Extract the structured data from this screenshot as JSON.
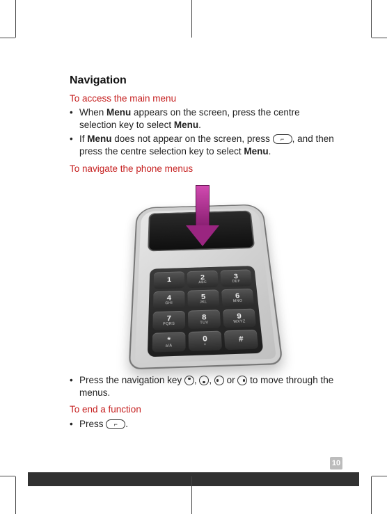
{
  "heading": "Navigation",
  "section_access": {
    "title": "To access the main menu",
    "bullets": [
      {
        "pre": "When ",
        "bold1": "Menu",
        "mid": " appears on the screen, press the centre selection key to select ",
        "bold2": "Menu",
        "post": "."
      },
      {
        "pre": "If ",
        "bold1": "Menu",
        "mid": " does not appear on the screen, press ",
        "icon": "hangup",
        "mid2": ", and then press the centre selection key to select ",
        "bold2": "Menu",
        "post": "."
      }
    ]
  },
  "section_navigate": {
    "title": "To navigate the phone menus"
  },
  "keypad": [
    {
      "digit": "1",
      "letters": ""
    },
    {
      "digit": "2",
      "letters": "ABC"
    },
    {
      "digit": "3",
      "letters": "DEF"
    },
    {
      "digit": "4",
      "letters": "GHI"
    },
    {
      "digit": "5",
      "letters": "JKL"
    },
    {
      "digit": "6",
      "letters": "MNO"
    },
    {
      "digit": "7",
      "letters": "PQRS"
    },
    {
      "digit": "8",
      "letters": "TUV"
    },
    {
      "digit": "9",
      "letters": "WXYZ"
    },
    {
      "digit": "*",
      "letters": "a/A"
    },
    {
      "digit": "0",
      "letters": "+"
    },
    {
      "digit": "#",
      "letters": ""
    }
  ],
  "section_press": {
    "bullet_pre": "Press the navigation key ",
    "bullet_sep": ", ",
    "bullet_or": " or ",
    "bullet_post": " to move through the menus."
  },
  "section_end": {
    "title": "To end a function",
    "bullet_pre": "Press ",
    "bullet_post": "."
  },
  "page_number": "10"
}
